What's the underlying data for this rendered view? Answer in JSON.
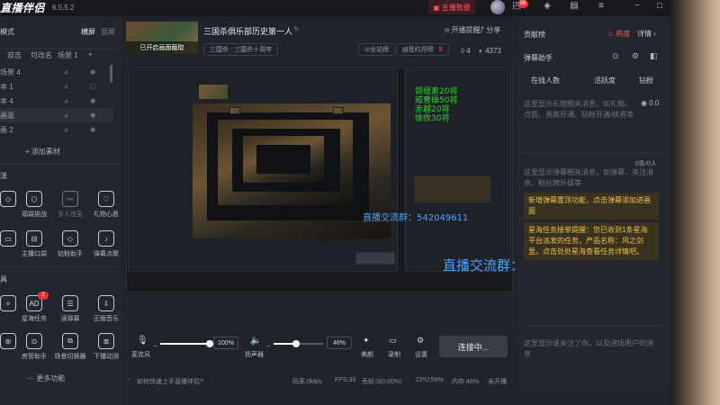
{
  "app": {
    "name": "直播伴侣",
    "version": "6.5.5.2"
  },
  "topbar": {
    "data_button": "主播数据",
    "notif_count": "98"
  },
  "left": {
    "scene_mode_label": "模式",
    "scene_tab_landscape": "横屏",
    "scene_tab_portrait": "竖屏",
    "scene_tabs": [
      "双击",
      "可改名",
      "场景 1"
    ],
    "sources": [
      "场景 4",
      "本 1",
      "本 4",
      "画面",
      "画 2"
    ],
    "add_material": "添加素材",
    "tools_label": "法",
    "tools_row1": [
      "",
      "福袋挑战",
      "多人连麦",
      "礼物心愿"
    ],
    "tools_row2": [
      "",
      "主播口袋",
      "钻粉助手",
      "弹幕点歌"
    ],
    "tools2_label": "具",
    "tools_row3": [
      "",
      "星海任务",
      "读弹幕",
      "正版音乐"
    ],
    "tools_row4": [
      "",
      "房管助手",
      "场景切换器",
      "下播动测"
    ],
    "tool_badge": "1",
    "more_fn": "更多功能"
  },
  "header": {
    "thumb_overlay": "已开启画面截取",
    "room_title": "三国杀俱乐部历史第一人",
    "tags": [
      "三国杀 - 三国杀十周年",
      "全站榜",
      "签约月榜"
    ],
    "rank_value": "5",
    "actions": [
      "开播提醒",
      "分享"
    ],
    "stats": {
      "likes": "4",
      "viewers": "4373"
    }
  },
  "controls": {
    "mic_label": "麦克风",
    "mic_pct": "100%",
    "speaker_label": "扬声器",
    "speaker_pct": "46%",
    "beauty_label": "美颜",
    "record_label": "录制",
    "settings_label": "设置",
    "connect_label": "连接中...",
    "slider_values": {
      "mic": 1.0,
      "speaker": 0.46
    }
  },
  "statusbar": {
    "help": "如何快速上手直播伴侣?",
    "bitrate": "码率:0kb/s",
    "fps": "FPS:30",
    "drop": "丢帧:0(0.00%)",
    "cpu": "CPU:56%",
    "mem": "内存:49%",
    "network": "未开播"
  },
  "right": {
    "tab_label": "贡献榜",
    "hot": "热度",
    "details": "详情",
    "danmu_label": "弹幕助手",
    "online": "在线人数",
    "active": "活跃度",
    "diamond": "钻粉",
    "gift_placeholder": "这里显示礼物相关消息，如礼物、点赞、贵族开通、钻粉开通/续费等",
    "gift_value": "0.0",
    "danmu_count": "0条/0人",
    "danmu_placeholder": "这里显示弹幕相关消息，如弹幕、关注消息、粉丝牌升级等",
    "notice1": "新增弹幕置顶功能，点击弹幕添加进画面",
    "notice2": "星海任务接单提醒：您已收到1条星海平台派发的任务，产品名称：风之剑里。点击处处星海查看任务详情吧。",
    "enter_placeholder": "这里显示谁关注了你，以及进场用户的消息"
  },
  "overlay": {
    "poll_lines": [
      "郭缇素20将",
      "威曹操50将",
      "赤越20将",
      "徐攸30将"
    ],
    "qq_group": "直播交流群：542049611",
    "colors": {
      "green": "#2cd52c",
      "blue": "#49a6ff"
    }
  }
}
